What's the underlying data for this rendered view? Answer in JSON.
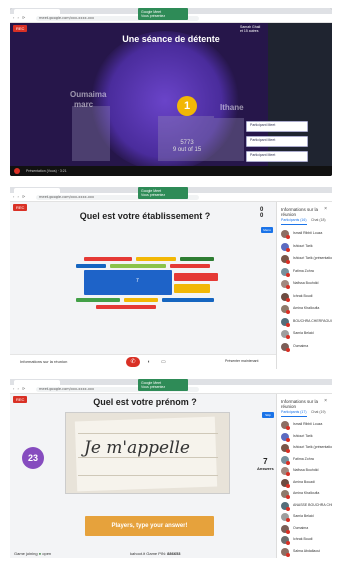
{
  "browser": {
    "url": "meet.google.com/xxx-xxxx-xxx",
    "banner_title": "Google Meet",
    "banner_sub": "Vous présentez"
  },
  "panel1": {
    "rec_label": "REC",
    "slide_title": "Une séance de détente",
    "name_left": "Oumaima",
    "name_left2": "marc",
    "name_right": "Ithane",
    "podium_rank": "1",
    "podium_score": "5773",
    "podium_correct": "9 out of 15",
    "presenter_name": "Presenter (Vous)",
    "topright_name": "Samah Ghali",
    "topright_sub": "et 15 autres",
    "tiles": [
      "Participant Meet",
      "Participant Meet",
      "Participant Meet"
    ],
    "bottom_label": "Présentation (Vous) · 3:21"
  },
  "panel2": {
    "rec_label": "REC",
    "slide_title": "Quel est votre établissement ?",
    "count_top": "0",
    "count_bottom": "0",
    "mini_button": "Menu",
    "controls_info": "Informations sur la réunion",
    "share_label": "Présenter maintenant",
    "wordcloud_center": "7",
    "info_panel": {
      "heading": "Informations sur la réunion",
      "tab1": "Participants (16)",
      "tab2": "Chat (18)",
      "participants": [
        "Ismail Ribbii Louza",
        "Ishiouri Tarik",
        "Ishiouri Tarik (présentation)",
        "Fatima Zohra",
        "Nafissa Bouhdid",
        "Ichrak Boudi",
        "Amina Khalloufia",
        "BOUCHRA CHERFAOUI",
        "Samia Belaid",
        "Oumaima"
      ]
    }
  },
  "panel3": {
    "rec_label": "REC",
    "slide_title": "Quel est votre prénom ?",
    "timer": "23",
    "answers_count": "7",
    "answers_label": "Answers",
    "photo_text": "Je m'appelle",
    "cta_text": "Players, type your answer!",
    "footer_left": "Game joining",
    "footer_left2": "open",
    "footer_right": "kahoot.it",
    "footer_pin_label": "Game PIN:",
    "footer_pin": "886653",
    "mini_button": "Skip",
    "info_panel": {
      "heading": "Informations sur la réunion",
      "tab1": "Participants (17)",
      "tab2": "Chat (19)",
      "participants": [
        "Ismail Ribbii Louza",
        "Ishiouri Tarik",
        "Ishiouri Tarik (présentation)",
        "Fatima Zohra",
        "Nafissa Bouhdid",
        "Amina Bouadi",
        "Amina Khalloufia",
        "ANASSE BOUCHRA CHERFAOUI",
        "Samia Belaid",
        "Oumaima",
        "Ichrak Boudi",
        "Salma Abdallaoui"
      ]
    }
  },
  "colors": {
    "kahoot_purple": "#864cbf",
    "meet_red": "#d93025",
    "meet_green": "#2e8b57",
    "answer_orange": "#e6a23c",
    "podium_gold": "#f2b705"
  }
}
